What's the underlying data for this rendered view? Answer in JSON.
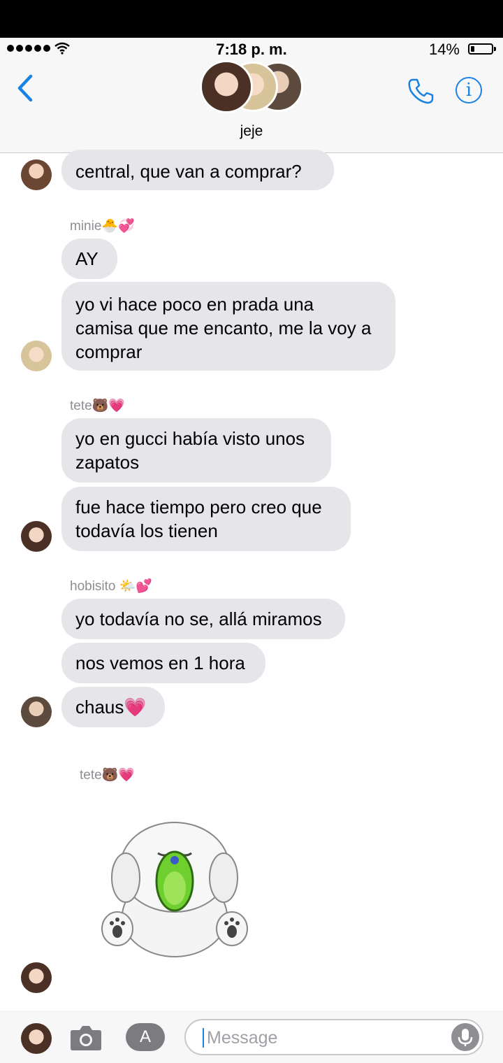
{
  "status_bar": {
    "time": "7:18 p. m.",
    "battery": "14%"
  },
  "header": {
    "group_name": "jeje"
  },
  "messages": [
    {
      "text": "central, que van a comprar?"
    },
    {
      "sender": "minie🐣💞"
    },
    {
      "text": "AY"
    },
    {
      "text_lines": [
        "yo vi hace poco en prada una",
        "camisa que me encanto, me la voy a",
        "comprar"
      ]
    },
    {
      "sender": "tete🐻💗"
    },
    {
      "text_lines": [
        "yo en gucci había visto unos",
        "zapatos"
      ]
    },
    {
      "text_lines": [
        "fue hace tiempo pero creo que",
        "todavía los tienen"
      ]
    },
    {
      "sender": "hobisito 🌤️💕"
    },
    {
      "text": "yo todavía no se, allá miramos"
    },
    {
      "text": "nos vemos en 1 hora"
    },
    {
      "text": "chaus💗"
    },
    {
      "sender": "tete🐻💗"
    }
  ],
  "composer": {
    "placeholder": "Message"
  },
  "colors": {
    "accent": "#1a82e2",
    "bubble": "#e5e5ea"
  }
}
